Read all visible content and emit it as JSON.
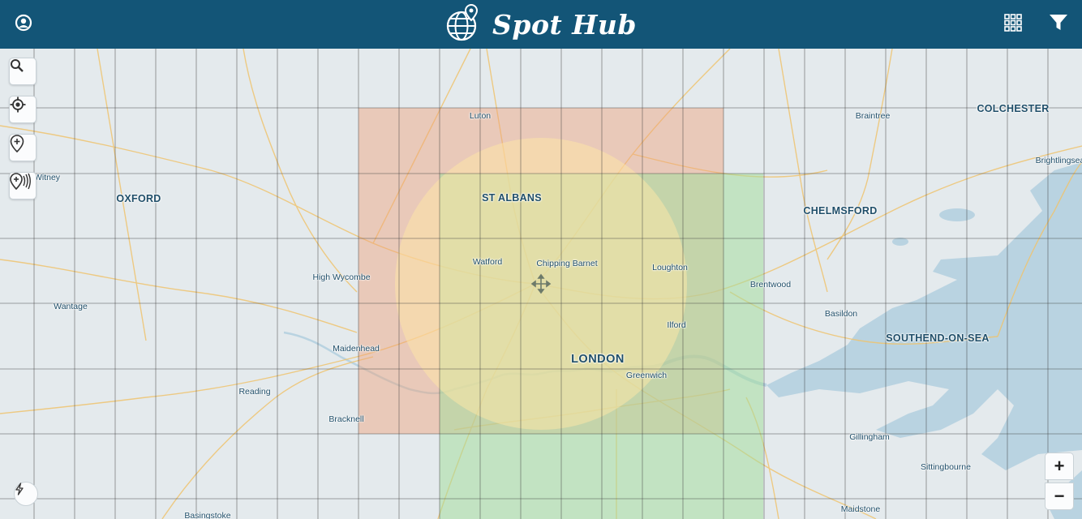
{
  "header": {
    "app_name": "Spot Hub",
    "background_color": "#135577",
    "logo_icon": "globe-pin-icon",
    "left_icon": "user-circle-icon",
    "right_icons": [
      "grid-menu-icon",
      "filter-icon"
    ]
  },
  "map_controls": {
    "left": [
      "search-icon",
      "locate-icon",
      "add-pin-icon",
      "add-signal-pin-icon"
    ],
    "bottom_left": "lightning-icon",
    "zoom_in_label": "+",
    "zoom_out_label": "−"
  },
  "map": {
    "places": [
      {
        "name": "Luton",
        "kind": "town"
      },
      {
        "name": "Braintree",
        "kind": "town"
      },
      {
        "name": "COLCHESTER",
        "kind": "city"
      },
      {
        "name": "Brightlingsea",
        "kind": "town"
      },
      {
        "name": "Witney",
        "kind": "town"
      },
      {
        "name": "OXFORD",
        "kind": "city"
      },
      {
        "name": "ST ALBANS",
        "kind": "city"
      },
      {
        "name": "CHELMSFORD",
        "kind": "city"
      },
      {
        "name": "Watford",
        "kind": "town"
      },
      {
        "name": "Chipping Barnet",
        "kind": "town"
      },
      {
        "name": "Loughton",
        "kind": "town"
      },
      {
        "name": "High Wycombe",
        "kind": "town"
      },
      {
        "name": "Brentwood",
        "kind": "town"
      },
      {
        "name": "Wantage",
        "kind": "town"
      },
      {
        "name": "Basildon",
        "kind": "town"
      },
      {
        "name": "Ilford",
        "kind": "town"
      },
      {
        "name": "SOUTHEND-ON-SEA",
        "kind": "city"
      },
      {
        "name": "Maidenhead",
        "kind": "town"
      },
      {
        "name": "LONDON",
        "kind": "capital"
      },
      {
        "name": "Greenwich",
        "kind": "town"
      },
      {
        "name": "Reading",
        "kind": "town"
      },
      {
        "name": "Bracknell",
        "kind": "town"
      },
      {
        "name": "Gillingham",
        "kind": "town"
      },
      {
        "name": "Sittingbourne",
        "kind": "town"
      },
      {
        "name": "Basingstoke",
        "kind": "town"
      },
      {
        "name": "Maidstone",
        "kind": "town"
      }
    ],
    "overlays": [
      {
        "name": "orange-zone",
        "color": "#f0b08a"
      },
      {
        "name": "green-zone",
        "color": "#a6dd9f"
      },
      {
        "name": "yellow-circle",
        "color": "#ffe7a6"
      }
    ],
    "colors": {
      "water": "#b9d3e1",
      "land": "#e4eaed",
      "roads": "#efc470",
      "grid": "#3c3c3c"
    }
  }
}
